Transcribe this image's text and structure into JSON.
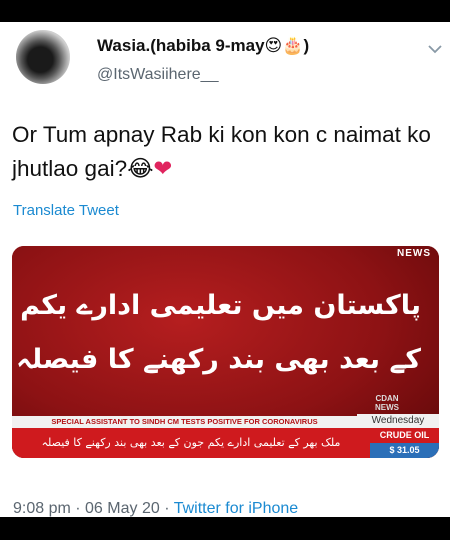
{
  "tweet": {
    "display_name": "Wasia.(habiba 9-may",
    "display_name_emojis": "😍🎂",
    "display_name_suffix": ")",
    "username": "@ItsWasiihere__",
    "text": "Or Tum apnay Rab ki kon kon c naimat ko jhutlao gai?",
    "text_emoji_laugh": "😂",
    "text_emoji_heart": "❤",
    "translate_label": "Translate Tweet",
    "time": "9:08 pm",
    "date": "06 May 20",
    "source": "Twitter for iPhone",
    "separator": " · "
  },
  "media": {
    "news_tag": "NEWS",
    "headline_line1": "پاکستان میں تعلیمی ادارے یکم جون",
    "headline_line2": "کے بعد بھی بند رکھنے کا فیصلہ",
    "channel_logo": "CDAN\nNEWS",
    "ticker_headline": "SPECIAL ASSISTANT TO SINDH CM TESTS POSITIVE FOR CORONAVIRUS",
    "ticker_day": "Wednesday",
    "ticker_urdu": "ملک بھر کے تعلیمی ادارے یکم جون کے بعد بھی بند رکھنے کا فیصلہ",
    "crude_label": "CRUDE OIL",
    "crude_value": "$ 31.05"
  },
  "colors": {
    "link_blue": "#1b8ad1",
    "heart_red": "#e0245e",
    "news_red": "#cf1a1e"
  }
}
